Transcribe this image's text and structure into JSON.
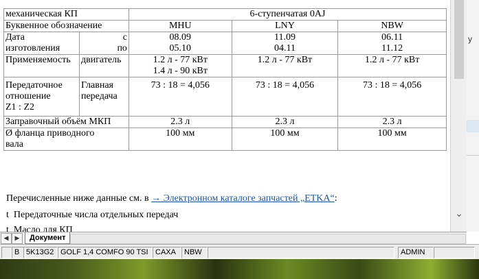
{
  "table": {
    "row1": {
      "label": "механическая КП",
      "value": "6-ступенчатая 0AJ"
    },
    "row2": {
      "label": "Буквенное обозначение",
      "values": [
        "MHU",
        "LNY",
        "NBW"
      ]
    },
    "row3": {
      "label_a": "Дата",
      "label_b": "изготовления",
      "sub_a": "с",
      "sub_b": "по",
      "values": [
        [
          "08.09",
          "05.10"
        ],
        [
          "11.09",
          "04.11"
        ],
        [
          "06.11",
          "11.12"
        ]
      ]
    },
    "row4": {
      "label": "Применяемость",
      "sub": "двигатель",
      "values": [
        [
          "1.2 л - 77 кВт",
          "1.4 л - 90 кВт"
        ],
        [
          "1.2 л - 77 кВт"
        ],
        [
          "1.2 л - 77 кВт"
        ]
      ]
    },
    "row5": {
      "label_a": "Передаточное",
      "label_b": "отношение",
      "label_c": "Z1 : Z2",
      "sub_a": "Главная",
      "sub_b": "передача",
      "values": [
        "73 : 18 = 4,056",
        "73 : 18 = 4,056",
        "73 : 18 = 4,056"
      ]
    },
    "row6": {
      "label": "Заправочный объём МКП",
      "values": [
        "2.3 л",
        "2.3 л",
        "2.3 л"
      ]
    },
    "row7": {
      "label_a": "Ø фланца приводного",
      "label_b": "вала",
      "values": [
        "100 мм",
        "100 мм",
        "100 мм"
      ]
    }
  },
  "intro": {
    "before": "Перечисленные ниже данные см. в ",
    "link": "→ Электронном каталоге запчастей „ETKA“",
    "after": ":"
  },
  "bullets": [
    {
      "marker": "t",
      "text": "Передаточные числа отдельных передач"
    },
    {
      "marker": "t",
      "text": "Масло для КП"
    }
  ],
  "tabbar": {
    "tab_label": "Документ"
  },
  "statusbar": {
    "items": [
      "B",
      "5K13G2",
      "GOLF 1,4 COMFO 90 TSI",
      "CAXA",
      "NBW",
      "ADMIN"
    ]
  },
  "rightwin": {
    "text": "y"
  }
}
